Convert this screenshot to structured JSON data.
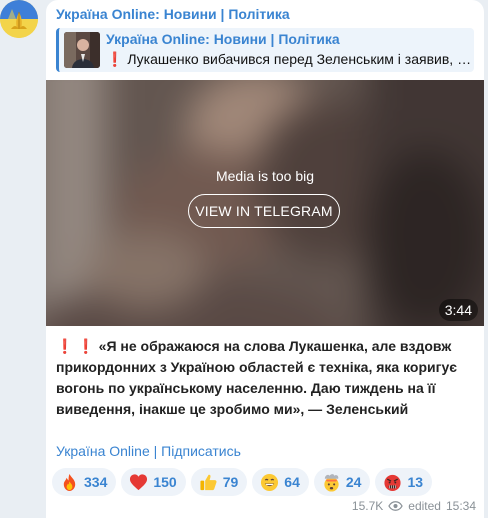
{
  "channel": {
    "name": "Україна Online: Новини | Політика"
  },
  "reply": {
    "title": "Україна Online: Новини | Політика",
    "exclamation": "❗",
    "text": "Лукашенко вибачився перед Зеленським і заявив, що він ніколи не піде війною на Україну"
  },
  "media": {
    "message": "Media is too big",
    "button_label": "VIEW IN TELEGRAM",
    "duration": "3:44"
  },
  "post": {
    "exclamations": "❗ ❗",
    "text": "«Я не ображаюся на слова Лукашенка, але вздовж прикордонних з Україною областей є техніка, яка коригує вогонь по українському населенню. Даю тиждень на її виведення, інакше це зробимо ми», — Зеленський",
    "signature": "Україна Online | Підписатись"
  },
  "reactions": [
    {
      "icon": "fire-icon",
      "count": "334"
    },
    {
      "icon": "heart-icon",
      "count": "150"
    },
    {
      "icon": "thumbs-up-icon",
      "count": "79"
    },
    {
      "icon": "grin-face-icon",
      "count": "64"
    },
    {
      "icon": "exploding-head-icon",
      "count": "24"
    },
    {
      "icon": "angry-face-icon",
      "count": "13"
    }
  ],
  "meta": {
    "views": "15.7K",
    "edited": "edited",
    "time": "15:34"
  },
  "colors": {
    "accent": "#3a84d1",
    "background": "#e9eef3",
    "bubble": "#ffffff",
    "reaction_bg": "#eef3f9",
    "alert_red": "#d62828"
  }
}
